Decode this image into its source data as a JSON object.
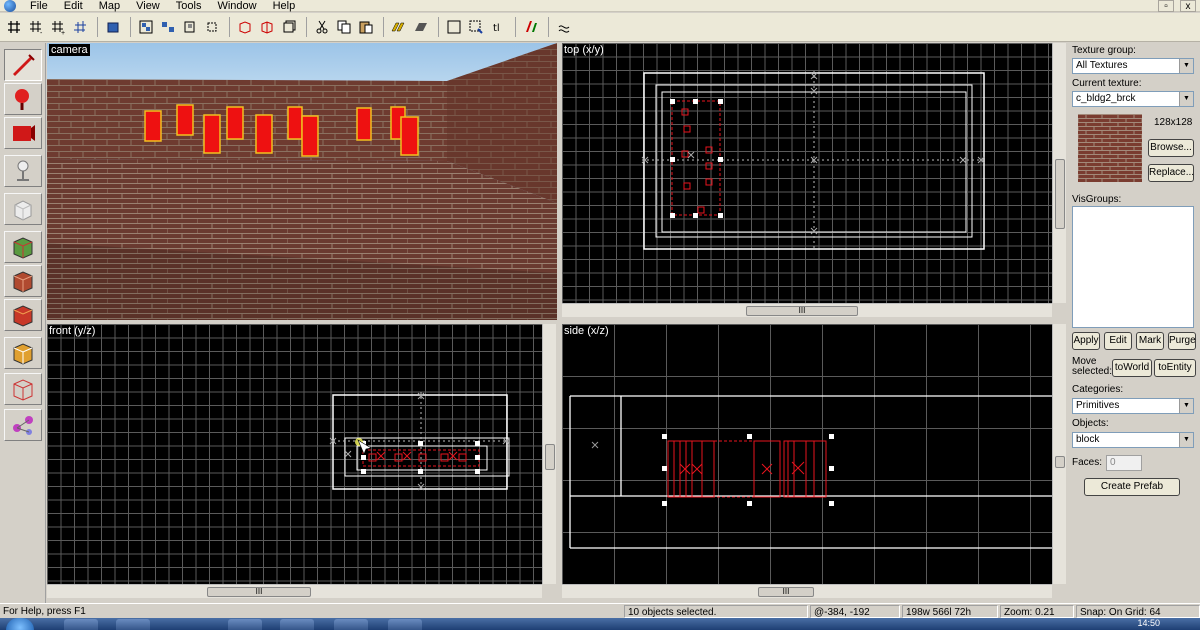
{
  "menubar": {
    "items": [
      "File",
      "Edit",
      "Map",
      "View",
      "Tools",
      "Window",
      "Help"
    ],
    "restore_glyph": "▫",
    "close_glyph": "x"
  },
  "toolbar": {
    "buttons": [
      "grid-toggle-icon",
      "grid-smaller-icon",
      "grid-larger-icon",
      "grid-3d-icon",
      "carve-icon",
      "group-icon",
      "ungroup-icon",
      "hide-icon",
      "cordon-icon",
      "texture-lock-icon",
      "cut-icon",
      "copy-icon",
      "paste-icon",
      "texture-browse-icon",
      "run-map-icon",
      "select-icon",
      "decal-icon",
      "entity-report-icon",
      "compile-icon"
    ]
  },
  "tools": {
    "items": [
      "selection-tool-icon",
      "magnify-tool-icon",
      "camera-tool-icon",
      "entity-tool-icon",
      "block-tool-icon",
      "texture-application-icon",
      "apply-texture-icon",
      "decal-tool-icon",
      "overlay-tool-icon",
      "clipping-tool-icon",
      "vertex-tool-icon"
    ]
  },
  "viewports": {
    "camera_title": "camera",
    "top_title": "top (x/y)",
    "front_title": "front (y/z)",
    "side_title": "side (x/z)",
    "scroll_grip": "III"
  },
  "panel": {
    "texture_group_label": "Texture group:",
    "texture_group_value": "All Textures",
    "current_texture_label": "Current texture:",
    "current_texture_value": "c_bldg2_brck",
    "texture_size": "128x128",
    "browse_label": "Browse...",
    "replace_label": "Replace...",
    "visgroups_label": "VisGroups:",
    "apply_label": "Apply",
    "edit_label": "Edit",
    "mark_label": "Mark",
    "purge_label": "Purge",
    "move_selected_label": "Move selected:",
    "to_world_label": "toWorld",
    "to_entity_label": "toEntity",
    "categories_label": "Categories:",
    "categories_value": "Primitives",
    "objects_label": "Objects:",
    "objects_value": "block",
    "faces_label": "Faces:",
    "faces_value": "0",
    "create_prefab_label": "Create Prefab"
  },
  "statusbar": {
    "help_text": "For Help, press F1",
    "selection_text": "10 objects selected.",
    "coords_text": "@-384, -192",
    "size_text": "198w 566l 72h",
    "zoom_text": "Zoom: 0.21",
    "snap_text": "Snap: On Grid: 64"
  },
  "taskbar": {
    "clock": "14:50"
  },
  "colors": {
    "grid": "#5a5a5a",
    "selection": "#e8141e",
    "brush_white": "#ffffff",
    "sky": "#8fb7dc",
    "brick": "#6e3b30"
  }
}
